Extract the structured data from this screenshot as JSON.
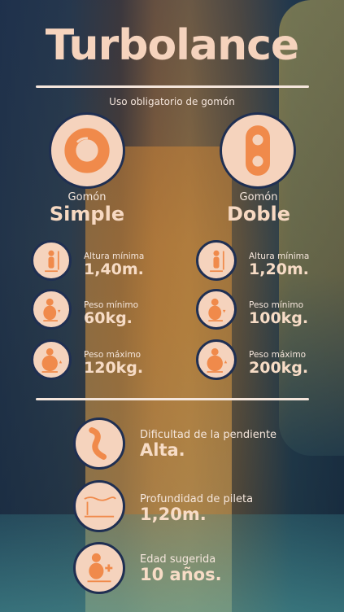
{
  "title": "Turbolance",
  "subtitle": "Uso obligatorio de gomón",
  "tubes": [
    {
      "small": "Gomón",
      "big": "Simple",
      "icon": "single-ring-icon"
    },
    {
      "small": "Gomón",
      "big": "Doble",
      "icon": "double-ring-icon"
    }
  ],
  "simple": [
    {
      "label": "Altura mínima",
      "value": "1,40m.",
      "icon": "height-icon"
    },
    {
      "label": "Peso mínimo",
      "value": "60kg.",
      "icon": "weight-min-icon"
    },
    {
      "label": "Peso máximo",
      "value": "120kg.",
      "icon": "weight-max-icon"
    }
  ],
  "doble": [
    {
      "label": "Altura mínima",
      "value": "1,20m.",
      "icon": "height-icon"
    },
    {
      "label": "Peso mínimo",
      "value": "100kg.",
      "icon": "weight-min-icon"
    },
    {
      "label": "Peso máximo",
      "value": "200kg.",
      "icon": "weight-max-icon"
    }
  ],
  "features": [
    {
      "label": "Dificultad de la pendiente",
      "value": "Alta.",
      "icon": "slope-icon"
    },
    {
      "label": "Profundidad de pileta",
      "value": "1,20m.",
      "icon": "pool-depth-icon"
    },
    {
      "label": "Edad sugerida",
      "value": "10 años.",
      "icon": "age-icon"
    }
  ],
  "colors": {
    "accent": "#f08a4b",
    "ring": "#f5d3bd",
    "outline": "#1f2f52"
  }
}
